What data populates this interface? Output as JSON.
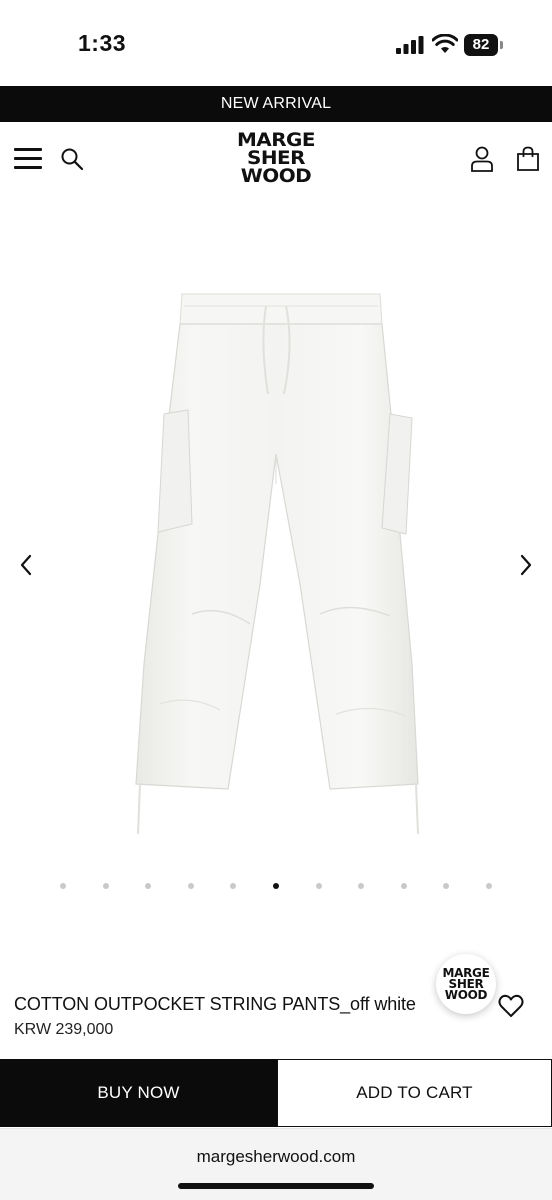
{
  "status_bar": {
    "time": "1:33",
    "battery": "82"
  },
  "banner": {
    "text": "NEW ARRIVAL"
  },
  "header": {
    "logo_lines": [
      "MARGE",
      "SHER",
      "WOOD"
    ]
  },
  "product": {
    "name": "COTTON OUTPOCKET STRING PANTS_off white",
    "price": "KRW 239,000"
  },
  "gallery": {
    "total_images": 11,
    "active_index": 5
  },
  "chat": {
    "logo_lines": [
      "MARGE",
      "SHER",
      "WOOD"
    ]
  },
  "actions": {
    "buy_now": "BUY NOW",
    "add_to_cart": "ADD TO CART"
  },
  "browser": {
    "url": "margesherwood.com"
  },
  "icons": [
    "signal-icon",
    "wifi-icon",
    "battery-icon",
    "menu-icon",
    "search-icon",
    "user-icon",
    "shopping-bag-icon",
    "chevron-left-icon",
    "chevron-right-icon",
    "heart-icon"
  ]
}
